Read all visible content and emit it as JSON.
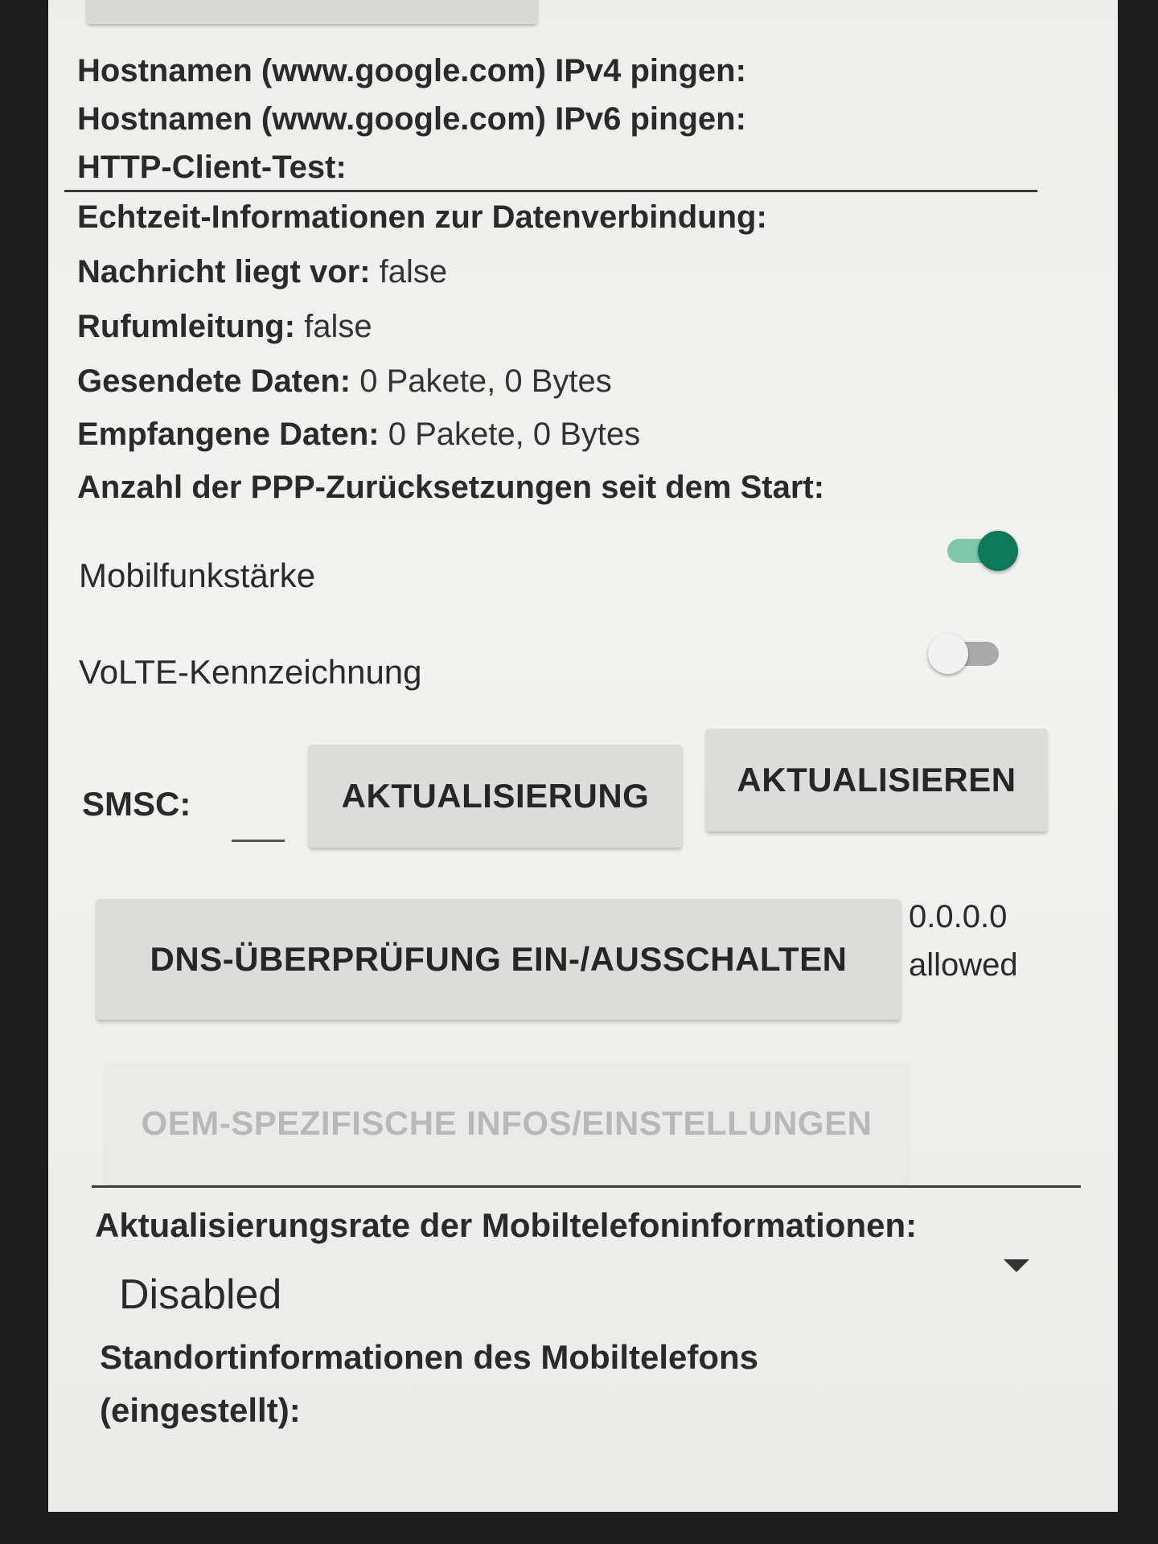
{
  "network_tests": {
    "ping_ipv4_label": "Hostnamen (www.google.com) IPv4 pingen:",
    "ping_ipv6_label": "Hostnamen (www.google.com) IPv6 pingen:",
    "http_client_label": "HTTP-Client-Test:"
  },
  "realtime": {
    "header": "Echtzeit-Informationen zur Datenverbindung:",
    "message_waiting_label": "Nachricht liegt vor:",
    "message_waiting_value": "false",
    "call_forwarding_label": "Rufumleitung:",
    "call_forwarding_value": "false",
    "sent_label": "Gesendete Daten:",
    "sent_value": "0 Pakete, 0 Bytes",
    "received_label": "Empfangene Daten:",
    "received_value": "0 Pakete, 0 Bytes",
    "ppp_resets_label": "Anzahl der PPP-Zurücksetzungen seit dem Start:"
  },
  "toggles": {
    "mobile_radio_label": "Mobilfunkstärke",
    "mobile_radio_on": true,
    "volte_label": "VoLTE-Kennzeichnung",
    "volte_on": false
  },
  "smsc": {
    "label": "SMSC:",
    "value": "",
    "update_button": "AKTUALISIERUNG",
    "refresh_button": "AKTUALISIEREN"
  },
  "dns": {
    "toggle_button": "DNS-ÜBERPRÜFUNG EIN-/AUSSCHALTEN",
    "address": "0.0.0.0",
    "status": "allowed"
  },
  "oem": {
    "button": "OEM-SPEZIFISCHE INFOS/EINSTELLUNGEN"
  },
  "refresh_rate": {
    "label": "Aktualisierungsrate der Mobiltelefoninformationen:",
    "selected": "Disabled"
  },
  "cell_location": {
    "label_line1": "Standortinformationen des Mobiltelefons",
    "label_line2": "(eingestellt):"
  },
  "colors": {
    "switch_on": "#0e7a5a",
    "switch_track_on": "#7fc8aa",
    "background": "#f2f3f0"
  }
}
